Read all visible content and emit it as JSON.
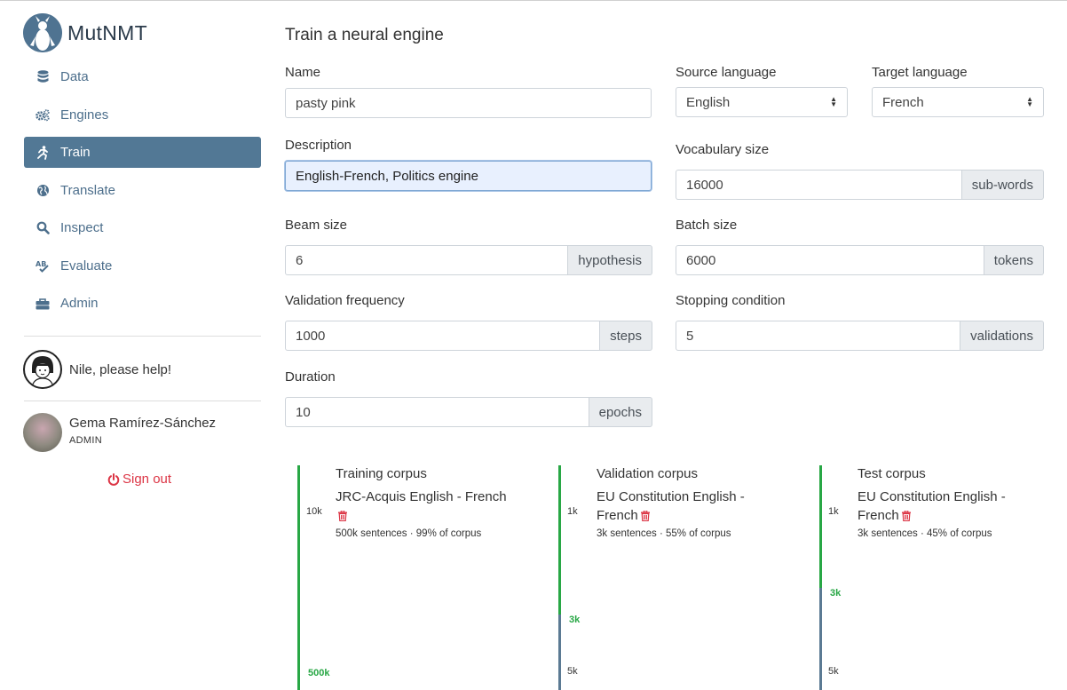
{
  "app": {
    "name": "MutNMT"
  },
  "sidebar": {
    "items": [
      {
        "label": "Data",
        "icon": "database-icon",
        "active": false
      },
      {
        "label": "Engines",
        "icon": "cogs-icon",
        "active": false
      },
      {
        "label": "Train",
        "icon": "running-icon",
        "active": true
      },
      {
        "label": "Translate",
        "icon": "globe-icon",
        "active": false
      },
      {
        "label": "Inspect",
        "icon": "search-icon",
        "active": false
      },
      {
        "label": "Evaluate",
        "icon": "spell-check-icon",
        "active": false
      },
      {
        "label": "Admin",
        "icon": "toolbox-icon",
        "active": false
      }
    ],
    "help_label": "Nile, please help!",
    "user": {
      "name": "Gema Ramírez-Sánchez",
      "role": "ADMIN"
    },
    "signout_label": "Sign out"
  },
  "form": {
    "title": "Train a neural engine",
    "name": {
      "label": "Name",
      "value": "pasty pink"
    },
    "source_language": {
      "label": "Source language",
      "value": "English"
    },
    "target_language": {
      "label": "Target language",
      "value": "French"
    },
    "description": {
      "label": "Description",
      "value": "English-French, Politics engine"
    },
    "vocabulary_size": {
      "label": "Vocabulary size",
      "value": "16000",
      "unit": "sub-words"
    },
    "beam_size": {
      "label": "Beam size",
      "value": "6",
      "unit": "hypothesis"
    },
    "batch_size": {
      "label": "Batch size",
      "value": "6000",
      "unit": "tokens"
    },
    "validation_frequency": {
      "label": "Validation frequency",
      "value": "1000",
      "unit": "steps"
    },
    "stopping_condition": {
      "label": "Stopping condition",
      "value": "5",
      "unit": "validations"
    },
    "duration": {
      "label": "Duration",
      "value": "10",
      "unit": "epochs"
    }
  },
  "corpora": [
    {
      "title": "Training corpus",
      "name": "JRC-Acquis English - French",
      "meta": "500k sentences · 99% of corpus",
      "tick_top": "10k",
      "tick_bottom": "500k",
      "selected_fraction": 0.99
    },
    {
      "title": "Validation corpus",
      "name": "EU Constitution English - French",
      "meta": "3k sentences · 55% of corpus",
      "tick_top": "1k",
      "tick_mid": "3k",
      "tick_bottom": "5k",
      "selected_fraction": 0.55
    },
    {
      "title": "Test corpus",
      "name": "EU Constitution English - French",
      "meta": "3k sentences · 45% of corpus",
      "tick_top": "1k",
      "tick_mid": "3k",
      "tick_bottom": "5k",
      "selected_fraction": 0.45
    }
  ],
  "colors": {
    "accent": "#527895",
    "success": "#28a745",
    "danger": "#dc3545",
    "addon_bg": "#e9ecef"
  }
}
